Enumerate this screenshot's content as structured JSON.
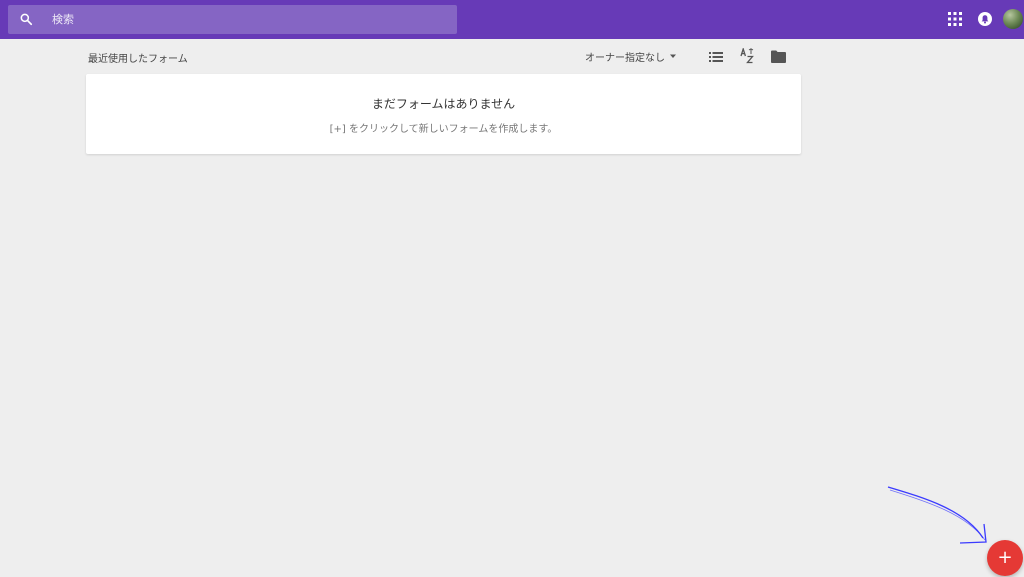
{
  "header": {
    "search": {
      "placeholder": "検索",
      "value": ""
    },
    "icons": [
      "search-icon",
      "apps-grid-icon",
      "notifications-icon",
      "avatar"
    ]
  },
  "toolbar": {
    "section_title": "最近使用したフォーム",
    "owner_filter_label": "オーナー指定なし",
    "icons": [
      "list-view-icon",
      "sort-az-icon",
      "folder-icon"
    ]
  },
  "empty_state": {
    "title": "まだフォームはありません",
    "subtitle": "[+] をクリックして新しいフォームを作成します。"
  },
  "fab": {
    "label": "+"
  },
  "colors": {
    "header_bg": "#673ab7",
    "search_bg": "#8565c4",
    "page_bg": "#eeeeee",
    "fab_bg": "#e53935",
    "annotation_arrow": "#3b3bff"
  }
}
